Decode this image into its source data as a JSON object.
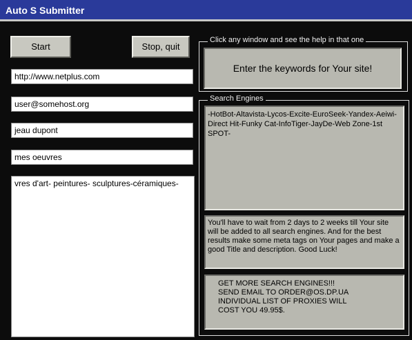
{
  "window": {
    "title": "Auto S Submitter"
  },
  "toolbar": {
    "start_label": "Start",
    "stop_label": "Stop, quit"
  },
  "fields": {
    "url": "http://www.netplus.com",
    "email": "user@somehost.org",
    "name": "jeau dupont",
    "title": "mes oeuvres",
    "keywords": "vres d'art- peintures- sculptures-céramiques-"
  },
  "help_group": {
    "legend": "Click any window and see the help in that one",
    "message": "Enter the keywords for Your site!"
  },
  "engines_group": {
    "legend": "Search Engines",
    "engines_text": "-HotBot-Altavista-Lycos-Excite-EuroSeek-Yandex-Aeiwi-Direct Hit-Funky Cat-InfoTiger-JayDe-Web Zone-1st SPOT-",
    "wait_text": "You'll have to wait from 2 days to 2 weeks till Your site will be added to all search engines. And for the best results make some meta tags on Your pages and make a good Title and description. Good Luck!",
    "more_text": "GET MORE SEARCH ENGINES!!!\nSEND EMAIL TO ORDER@OS.DP.UA\nINDIVIDUAL LIST OF PROXIES WILL\nCOST YOU 49.95$."
  }
}
